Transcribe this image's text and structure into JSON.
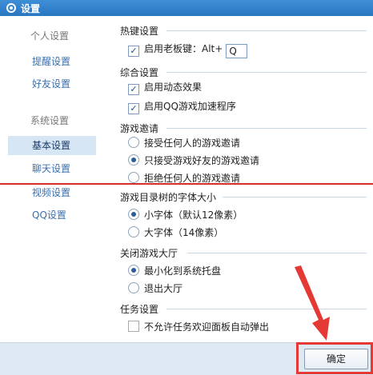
{
  "window": {
    "title": "设置"
  },
  "sidebar": {
    "groups": [
      {
        "label": "个人设置",
        "items": [
          "提醒设置",
          "好友设置"
        ]
      },
      {
        "label": "系统设置",
        "items": [
          "基本设置",
          "聊天设置",
          "视频设置",
          "QQ设置"
        ]
      }
    ],
    "active_item": "基本设置"
  },
  "sections": {
    "hotkey": {
      "title": "热键设置",
      "boss_key_label": "启用老板键：Alt+",
      "boss_key_value": "Q"
    },
    "general": {
      "title": "综合设置",
      "animation_label": "启用动态效果",
      "accelerate_label": "启用QQ游戏加速程序"
    },
    "invite": {
      "title": "游戏邀请",
      "options": [
        "接受任何人的游戏邀请",
        "只接受游戏好友的游戏邀请",
        "拒绝任何人的游戏邀请"
      ],
      "selected": 1
    },
    "font": {
      "title": "游戏目录树的字体大小",
      "options": [
        "小字体（默认12像素）",
        "大字体（14像素）"
      ],
      "selected": 0
    },
    "close": {
      "title": "关闭游戏大厅",
      "options": [
        "最小化到系统托盘",
        "退出大厅"
      ],
      "selected": 0
    },
    "task": {
      "title": "任务设置",
      "no_popup_label": "不允许任务欢迎面板自动弹出"
    }
  },
  "footer": {
    "ok_label": "确定"
  },
  "colors": {
    "titlebar": "#2a76c2",
    "highlight": "#e53935",
    "link": "#3a6fb0"
  }
}
